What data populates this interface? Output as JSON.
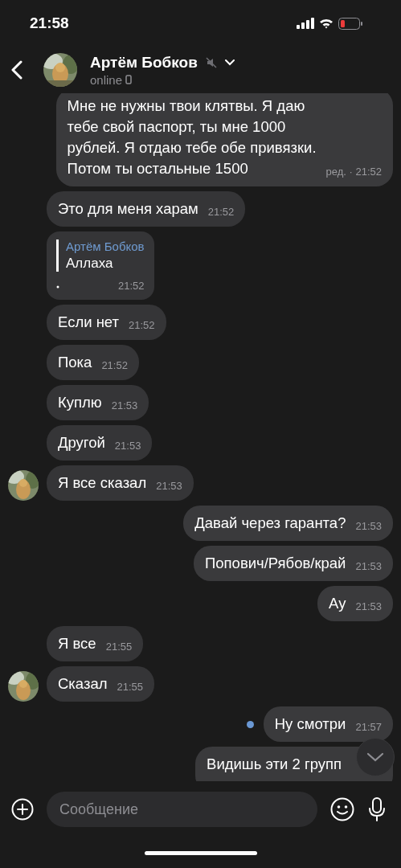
{
  "status_bar": {
    "time": "21:58"
  },
  "header": {
    "name": "Артём Бобков",
    "muted": true,
    "status": "online"
  },
  "messages": [
    {
      "out": true,
      "unread": false,
      "lines": [
        "Мне не нужны твои клятвы. Я даю",
        "тебе свой паспорт, ты мне 1000",
        "рублей. Я отдаю тебе обе привязки.",
        "Потом ты остальные 1500"
      ],
      "time": "ред. · 21:52"
    },
    {
      "out": false,
      "avatar": false,
      "unread": false,
      "lines": [
        "Это для меня харам"
      ],
      "time": "21:52"
    },
    {
      "out": false,
      "avatar": false,
      "unread": false,
      "quote": {
        "author": "Артём Бобков",
        "text": "Аллаха"
      },
      "time": "21:52"
    },
    {
      "out": false,
      "avatar": false,
      "unread": false,
      "lines": [
        "Если нет"
      ],
      "time": "21:52"
    },
    {
      "out": false,
      "avatar": false,
      "unread": false,
      "lines": [
        "Пока"
      ],
      "time": "21:52"
    },
    {
      "out": false,
      "avatar": false,
      "unread": false,
      "lines": [
        "Куплю"
      ],
      "time": "21:53"
    },
    {
      "out": false,
      "avatar": false,
      "unread": false,
      "lines": [
        "Другой"
      ],
      "time": "21:53"
    },
    {
      "out": false,
      "avatar": true,
      "unread": false,
      "lines": [
        "Я все сказал"
      ],
      "time": "21:53"
    },
    {
      "out": true,
      "unread": false,
      "lines": [
        "Давай через гаранта?"
      ],
      "time": "21:53"
    },
    {
      "out": true,
      "unread": false,
      "lines": [
        "Попович/Рябов/край"
      ],
      "time": "21:53"
    },
    {
      "out": true,
      "unread": false,
      "lines": [
        "Ау"
      ],
      "time": "21:53"
    },
    {
      "out": false,
      "avatar": false,
      "unread": false,
      "lines": [
        "Я все"
      ],
      "time": "21:55"
    },
    {
      "out": false,
      "avatar": true,
      "unread": false,
      "lines": [
        "Сказал"
      ],
      "time": "21:55"
    },
    {
      "out": true,
      "unread": true,
      "lines": [
        "Ну смотри"
      ],
      "time": "21:57"
    },
    {
      "out": true,
      "unread": false,
      "lines": [
        "Видишь эти 2 групп"
      ]
    }
  ],
  "composer": {
    "placeholder": "Сообщение"
  }
}
